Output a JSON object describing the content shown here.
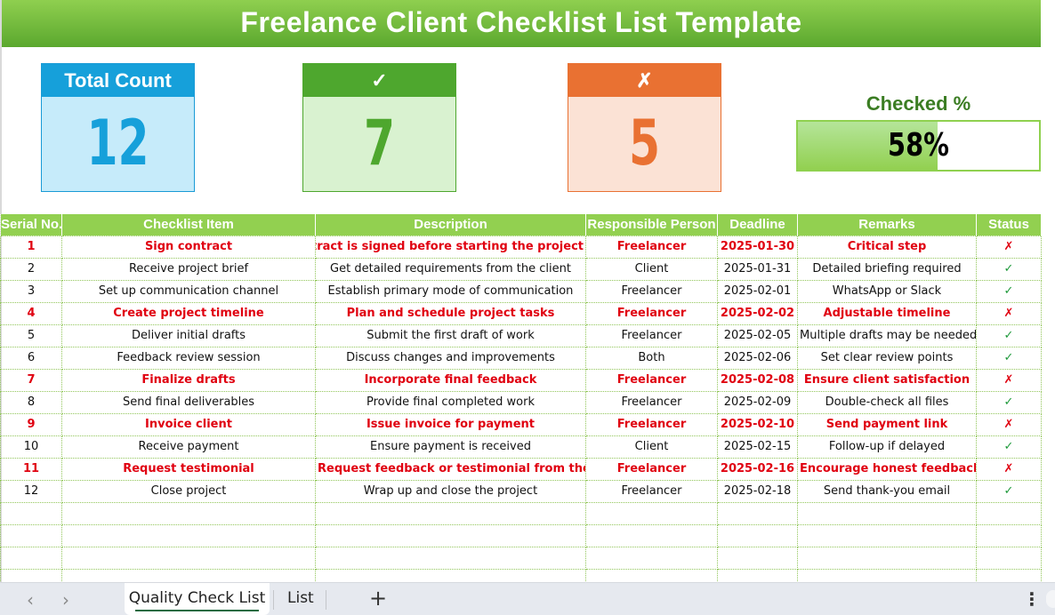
{
  "title": "Freelance Client Checklist List Template",
  "kpis": {
    "total": {
      "label": "Total Count",
      "value": "12",
      "color": "#16a0da"
    },
    "checked": {
      "label": "✓",
      "value": "7",
      "color": "#4ea72e"
    },
    "unchecked": {
      "label": "✗",
      "value": "5",
      "color": "#e97132"
    }
  },
  "checked_pct": {
    "label": "Checked %",
    "value_text": "58%",
    "fraction": 0.58
  },
  "table": {
    "headers": [
      "Serial No.",
      "Checklist Item",
      "Description",
      "Responsible Person",
      "Deadline",
      "Remarks",
      "Status"
    ],
    "rows": [
      {
        "serial": "1",
        "item": "Sign contract",
        "description": "Ensure contract is signed before starting the project",
        "person": "Freelancer",
        "deadline": "2025-01-30",
        "remarks": "Critical step",
        "status": "✗",
        "critical": true
      },
      {
        "serial": "2",
        "item": "Receive project brief",
        "description": "Get detailed requirements from the client",
        "person": "Client",
        "deadline": "2025-01-31",
        "remarks": "Detailed briefing required",
        "status": "✓",
        "critical": false
      },
      {
        "serial": "3",
        "item": "Set up communication channel",
        "description": "Establish primary mode of communication",
        "person": "Freelancer",
        "deadline": "2025-02-01",
        "remarks": "WhatsApp or Slack",
        "status": "✓",
        "critical": false
      },
      {
        "serial": "4",
        "item": "Create project timeline",
        "description": "Plan and schedule project tasks",
        "person": "Freelancer",
        "deadline": "2025-02-02",
        "remarks": "Adjustable timeline",
        "status": "✗",
        "critical": true
      },
      {
        "serial": "5",
        "item": "Deliver initial drafts",
        "description": "Submit the first draft of work",
        "person": "Freelancer",
        "deadline": "2025-02-05",
        "remarks": "Multiple drafts may be needed",
        "status": "✓",
        "critical": false
      },
      {
        "serial": "6",
        "item": "Feedback review session",
        "description": "Discuss changes and improvements",
        "person": "Both",
        "deadline": "2025-02-06",
        "remarks": "Set clear review points",
        "status": "✓",
        "critical": false
      },
      {
        "serial": "7",
        "item": "Finalize drafts",
        "description": "Incorporate final feedback",
        "person": "Freelancer",
        "deadline": "2025-02-08",
        "remarks": "Ensure client satisfaction",
        "status": "✗",
        "critical": true
      },
      {
        "serial": "8",
        "item": "Send final deliverables",
        "description": "Provide final completed work",
        "person": "Freelancer",
        "deadline": "2025-02-09",
        "remarks": "Double-check all files",
        "status": "✓",
        "critical": false
      },
      {
        "serial": "9",
        "item": "Invoice client",
        "description": "Issue invoice for payment",
        "person": "Freelancer",
        "deadline": "2025-02-10",
        "remarks": "Send payment link",
        "status": "✗",
        "critical": true
      },
      {
        "serial": "10",
        "item": "Receive payment",
        "description": "Ensure payment is received",
        "person": "Client",
        "deadline": "2025-02-15",
        "remarks": "Follow-up if delayed",
        "status": "✓",
        "critical": false
      },
      {
        "serial": "11",
        "item": "Request testimonial",
        "description": "Request feedback or testimonial from the client",
        "person": "Freelancer",
        "deadline": "2025-02-16",
        "remarks": "Encourage honest feedback",
        "status": "✗",
        "critical": true
      },
      {
        "serial": "12",
        "item": "Close project",
        "description": "Wrap up and close the project",
        "person": "Freelancer",
        "deadline": "2025-02-18",
        "remarks": "Send thank-you email",
        "status": "✓",
        "critical": false
      }
    ],
    "empty_rows": 4
  },
  "sheet_tabs": {
    "tabs": [
      "Quality Check List",
      "List"
    ],
    "active": "Quality Check List",
    "prev_icon": "‹",
    "next_icon": "›",
    "add_icon": "+",
    "more_icon": "⋮"
  }
}
